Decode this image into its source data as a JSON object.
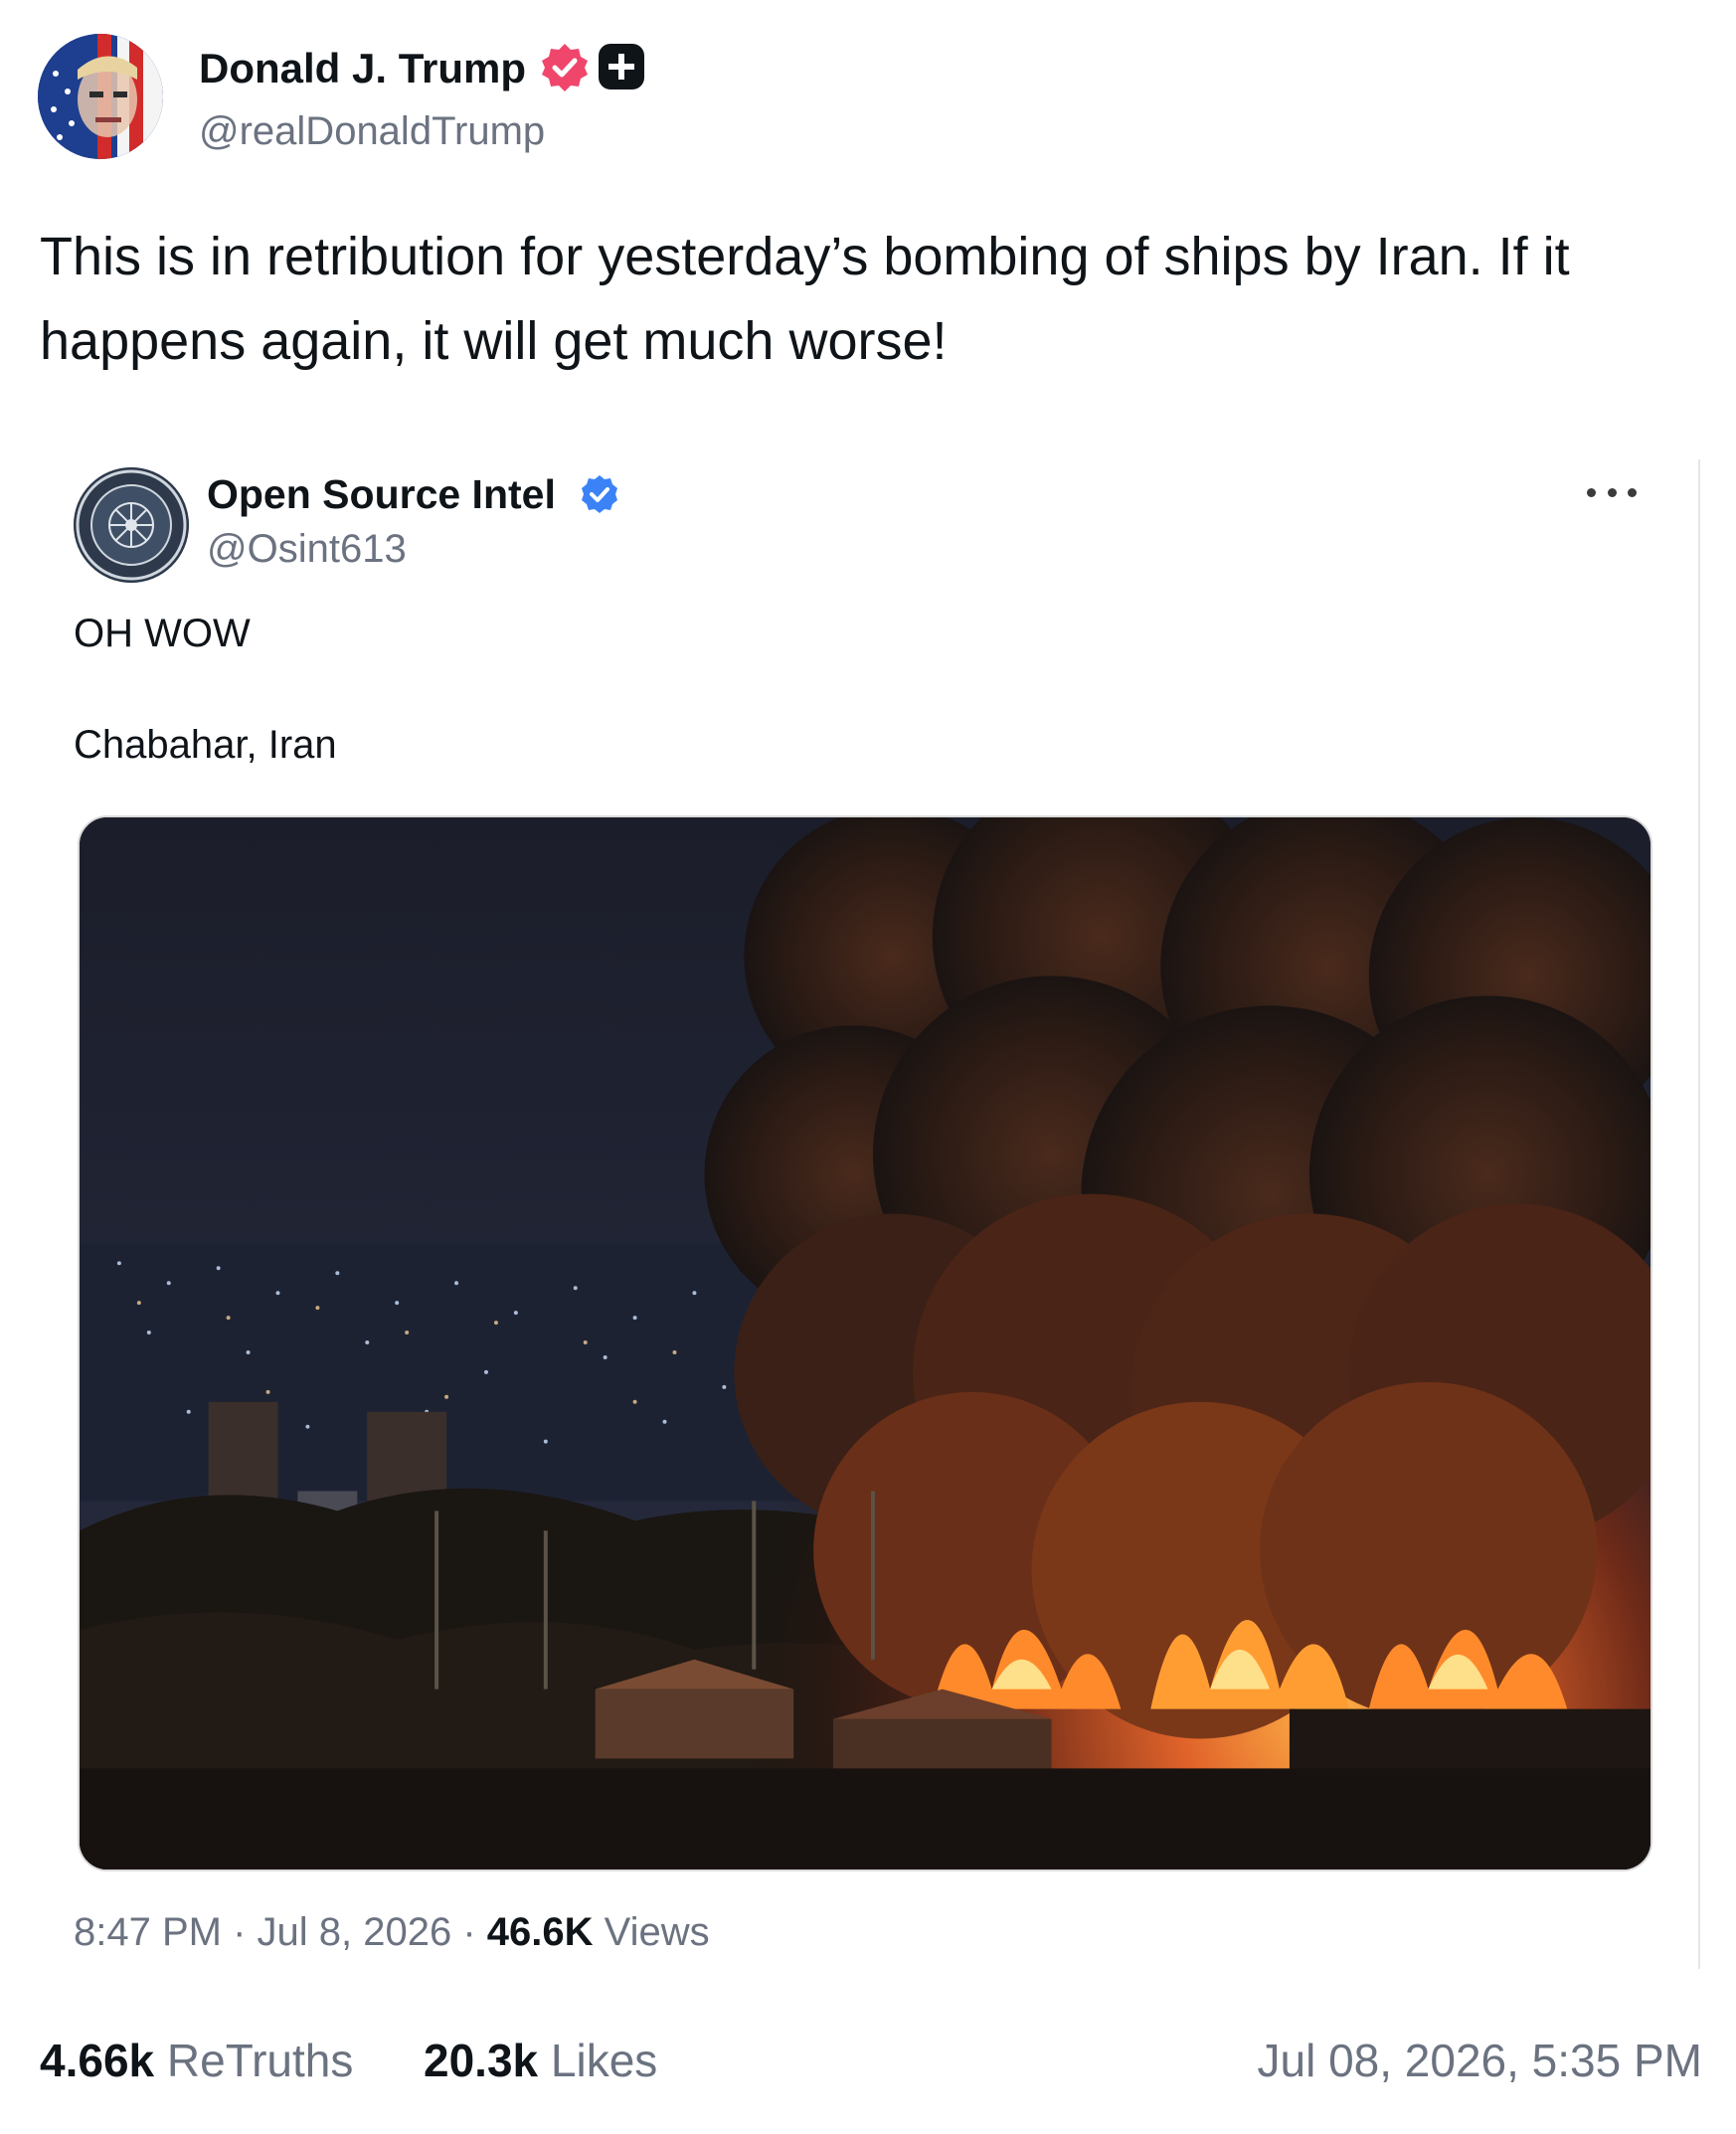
{
  "post": {
    "author_name": "Donald J. Trump",
    "author_handle": "@realDonaldTrump",
    "text": "This is in retribution for yesterday’s bombing of ships by Iran. If it happens again, it will get much worse!"
  },
  "quoted_post": {
    "author_name": "Open Source Intel",
    "author_handle": "@Osint613",
    "line1": "OH WOW",
    "line2": "Chabahar, Iran",
    "time": "8:47 PM",
    "separator": " · ",
    "date": "Jul 8, 2026",
    "views_count": "46.6K",
    "views_label": " Views"
  },
  "stats": {
    "retruths_count": "4.66k",
    "retruths_label": " ReTruths",
    "likes_count": "20.3k",
    "likes_label": " Likes",
    "timestamp": "Jul 08, 2026, 5:35 PM"
  },
  "icons": {
    "verified_badge": "verified-badge-icon",
    "plus_badge": "plus-badge-icon",
    "more": "more-icon"
  },
  "colors": {
    "verified_pink": "#f0466c",
    "verified_blue": "#3b82f6",
    "muted_text": "#6b7280",
    "primary_text": "#0f1419"
  }
}
